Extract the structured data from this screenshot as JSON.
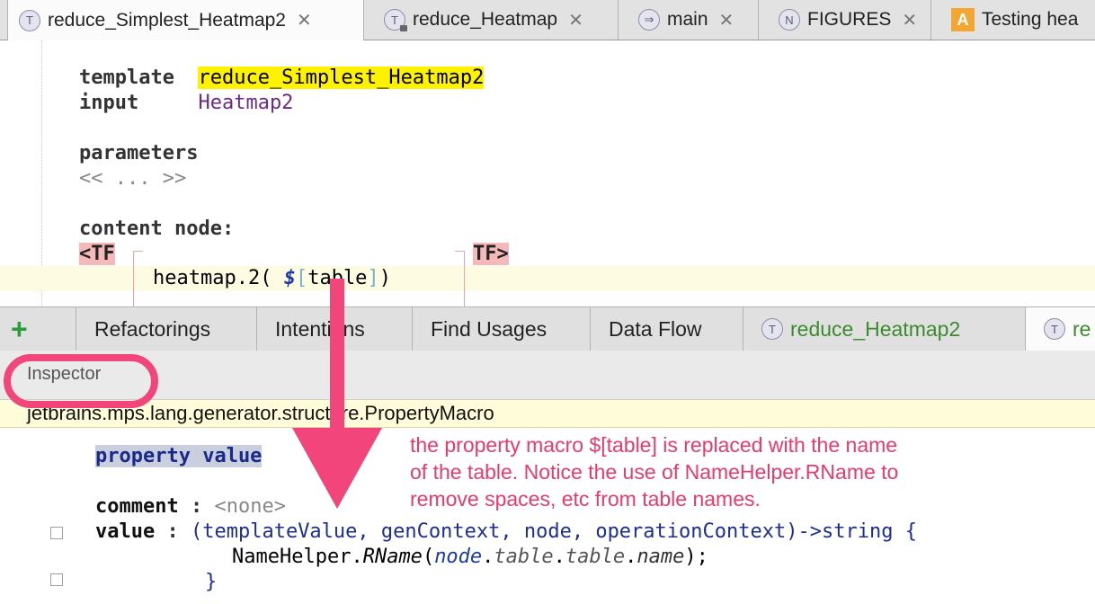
{
  "editor_tabs": [
    {
      "label": "reduce_Simplest_Heatmap2",
      "icon": "template-icon",
      "glyph": "T",
      "active": true,
      "close": "✕"
    },
    {
      "label": "reduce_Heatmap",
      "icon": "template-locked-icon",
      "glyph": "T",
      "active": false,
      "close": "✕"
    },
    {
      "label": "main",
      "icon": "arrow-right-icon",
      "glyph": "⇒",
      "active": false,
      "close": "✕"
    },
    {
      "label": "FIGURES",
      "icon": "node-icon",
      "glyph": "N",
      "active": false,
      "close": "✕"
    },
    {
      "label": "Testing hea",
      "icon": "a-icon",
      "glyph": "A",
      "active": false
    }
  ],
  "editor": {
    "template_kw": "template",
    "template_name": "reduce_Simplest_Heatmap2",
    "input_kw": "input",
    "input_value": "Heatmap2",
    "parameters_kw": "parameters",
    "parameters_value": "<< ... >>",
    "content_kw": "content node:",
    "tf_open": "<TF",
    "tf_close": "TF>",
    "code_prefix": "heatmap.2( ",
    "macro_dollar": "$",
    "macro_open": "[",
    "macro_body": "table",
    "macro_close": "]",
    "code_suffix": ")"
  },
  "tool_tabs": [
    {
      "label": "Refactorings"
    },
    {
      "label": "Intentions"
    },
    {
      "label": "Find Usages"
    },
    {
      "label": "Data Flow"
    },
    {
      "label": "reduce_Heatmap2",
      "glyph": "T"
    },
    {
      "label": "re",
      "glyph": "T"
    }
  ],
  "plus_label": "+",
  "inspector": {
    "title": "Inspector",
    "concept": "jetbrains.mps.lang.generator.structure.PropertyMacro",
    "property_value": "property value",
    "comment_kw": "comment",
    "colon": " : ",
    "comment_value": "<none>",
    "value_kw": "value",
    "signature": "(templateValue, genContext, node, operationContext)->string {",
    "body_class": "NameHelper.",
    "body_method": "RName",
    "body_open": "(",
    "body_node": "node",
    "body_dot": ".",
    "body_table1": "table",
    "body_table2": "table",
    "body_name": "name",
    "body_close": ");",
    "closing_brace": "}"
  },
  "annotation": {
    "lines": [
      "the property macro $[table] is replaced with the name",
      "of the table. Notice the use of NameHelper.RName to",
      "remove spaces, etc from table names."
    ],
    "color": "#ea3a6a"
  }
}
